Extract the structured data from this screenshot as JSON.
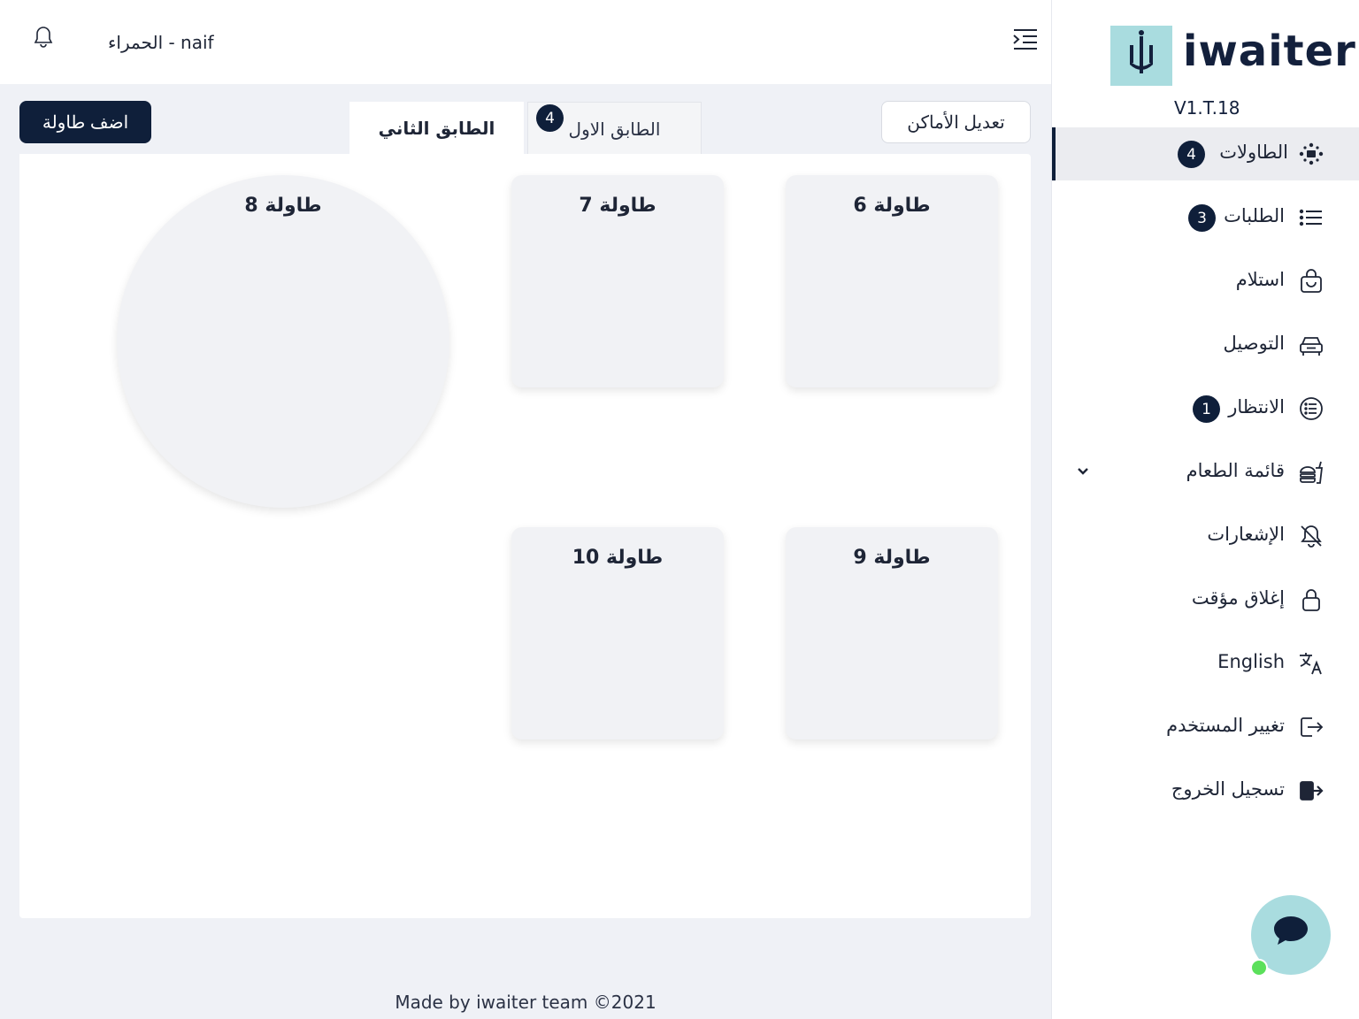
{
  "header": {
    "user_label": "الحمراء - naif"
  },
  "toolbar": {
    "add_table": "اضف طاولة",
    "edit_places": "تعديل الأماكن"
  },
  "tabs": [
    {
      "label": "الطابق الثاني",
      "active": true
    },
    {
      "label": "الطابق الاول",
      "badge": "4",
      "active": false
    }
  ],
  "tables": [
    {
      "label": "طاولة 6",
      "shape": "square"
    },
    {
      "label": "طاولة 7",
      "shape": "square"
    },
    {
      "label": "طاولة 8",
      "shape": "round"
    },
    {
      "label": "طاولة 9",
      "shape": "square"
    },
    {
      "label": "طاولة 10",
      "shape": "square"
    }
  ],
  "footer": "Made by iwaiter team ©2021",
  "sidebar": {
    "logo_text": "iwaiter",
    "version": "V1.T.18",
    "items": [
      {
        "label": "الطاولات",
        "icon": "tables-icon",
        "badge": "4",
        "active": true
      },
      {
        "label": "الطلبات",
        "icon": "list-icon",
        "badge": "3"
      },
      {
        "label": "استلام",
        "icon": "shopping-bag-icon"
      },
      {
        "label": "التوصيل",
        "icon": "car-icon"
      },
      {
        "label": "الانتظار",
        "icon": "queue-icon",
        "badge": "1"
      },
      {
        "label": "قائمة الطعام",
        "icon": "food-icon",
        "expandable": true
      },
      {
        "label": "الإشعارات",
        "icon": "bell-off-icon"
      },
      {
        "label": "إغلاق مؤقت",
        "icon": "lock-icon"
      },
      {
        "label": "English",
        "icon": "translate-icon"
      },
      {
        "label": "تغيير المستخدم",
        "icon": "switch-user-icon"
      },
      {
        "label": "تسجيل الخروج",
        "icon": "logout-icon"
      }
    ]
  },
  "colors": {
    "primary": "#0f1f3a",
    "accent": "#a9dcdf",
    "online": "#5be05b",
    "background": "#eff1f6"
  }
}
